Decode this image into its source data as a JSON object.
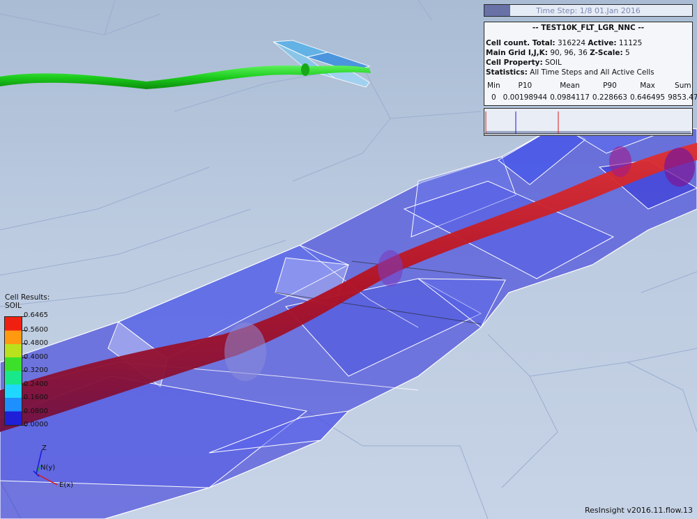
{
  "timestep": {
    "label": "Time Step: 1/8 01.Jan 2016",
    "progress_fraction": 0.125
  },
  "info": {
    "title": "-- TEST10K_FLT_LGR_NNC --",
    "cell_count_label": "Cell count. Total:",
    "cell_count_total": "316224",
    "active_label": "Active:",
    "active_value": "11125",
    "main_grid_label": "Main Grid I,J,K:",
    "main_grid_value": "90, 96, 36",
    "zscale_label": "Z-Scale:",
    "zscale_value": "5",
    "cell_property_label": "Cell Property:",
    "cell_property_value": "SOIL",
    "statistics_label": "Statistics:",
    "statistics_value": "All Time Steps and All Active Cells",
    "stats_headers": [
      "Min",
      "P10",
      "Mean",
      "P90",
      "Max",
      "Sum"
    ],
    "stats_values": [
      "0",
      "0.00198944",
      "0.0984117",
      "0.228663",
      "0.646495",
      "9853.47"
    ]
  },
  "legend": {
    "title_line1": "Cell Results:",
    "title_line2": "SOIL",
    "ticks": [
      "0.6465",
      "0.5600",
      "0.4800",
      "0.4000",
      "0.3200",
      "0.2400",
      "0.1600",
      "0.0800",
      "0.0000"
    ]
  },
  "axes": {
    "z": "Z",
    "n": "N(y)",
    "e": "E(x)"
  },
  "version": "ResInsight v2016.11.flow.13",
  "colors": {
    "background": "#bccbe0",
    "well_red": "#c01818",
    "well_green": "#20c820",
    "grid_blue": "#2a2ad8"
  }
}
